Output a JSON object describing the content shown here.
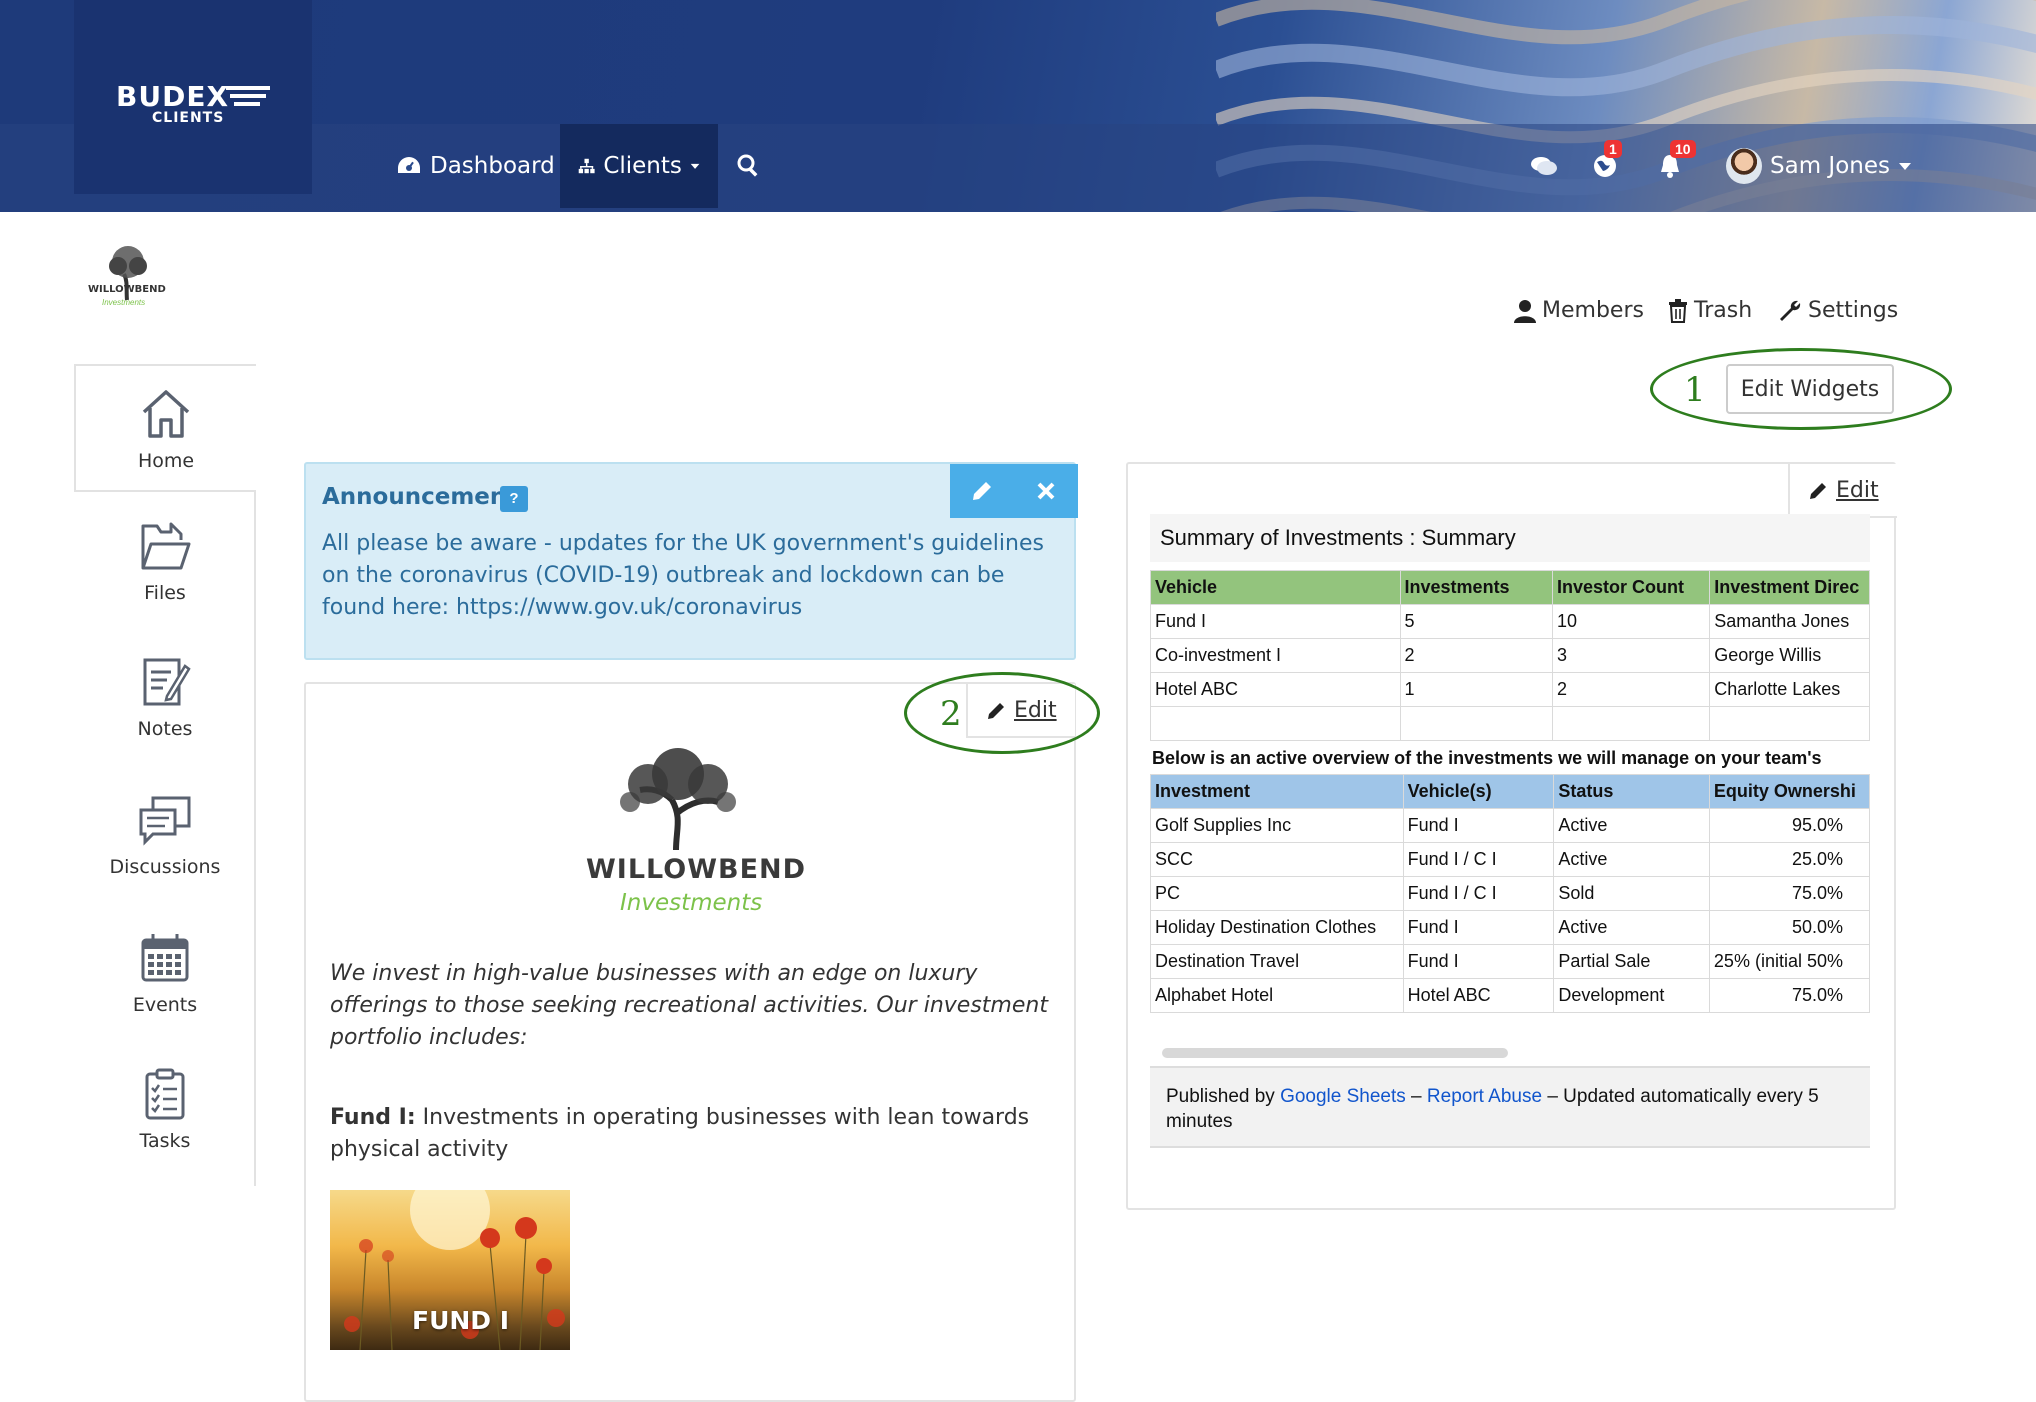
{
  "brand": {
    "name": "BUDEX",
    "sub": "CLIENTS"
  },
  "nav": {
    "dashboard": "Dashboard",
    "clients": "Clients",
    "messages_badge": "1",
    "notifications_badge": "10",
    "user_name": "Sam Jones"
  },
  "client_logo": {
    "name": "WILLOWBEND",
    "sub": "Investments"
  },
  "sidebar": {
    "items": [
      {
        "label": "Home",
        "icon": "home-icon"
      },
      {
        "label": "Files",
        "icon": "folder-icon"
      },
      {
        "label": "Notes",
        "icon": "note-icon"
      },
      {
        "label": "Discussions",
        "icon": "discussion-icon"
      },
      {
        "label": "Events",
        "icon": "calendar-icon"
      },
      {
        "label": "Tasks",
        "icon": "clipboard-icon"
      }
    ]
  },
  "toolbar": {
    "members": "Members",
    "trash": "Trash",
    "settings": "Settings",
    "edit_widgets": "Edit Widgets"
  },
  "annotations": {
    "marker_1": "1",
    "marker_2": "2"
  },
  "announcement": {
    "title": "Announcement",
    "help": "?",
    "body": "All please be aware - updates for the UK government's guidelines on the coronavirus (COVID-19) outbreak and lockdown can be found here: https://www.gov.uk/coronavirus"
  },
  "profile_widget": {
    "edit_label": "Edit",
    "logo_name": "WILLOWBEND",
    "logo_sub": "Investments",
    "intro": "We invest in high-value businesses with an edge on luxury offerings to those seeking recreational activities. Our investment portfolio includes:",
    "fund_label": "Fund I:",
    "fund_text": " Investments in operating businesses with lean towards physical activity",
    "fund_image_caption": "FUND I"
  },
  "summary_widget": {
    "edit_label": "Edit",
    "title": "Summary of Investments : Summary",
    "table1": {
      "headers": [
        "Vehicle",
        "Investments",
        "Investor Count",
        "Investment Direc"
      ],
      "rows": [
        [
          "Fund I",
          "5",
          "10",
          "Samantha Jones"
        ],
        [
          "Co-investment I",
          "2",
          "3",
          "George Willis"
        ],
        [
          "Hotel ABC",
          "1",
          "2",
          "Charlotte Lakes"
        ],
        [
          "",
          "",
          "",
          ""
        ]
      ]
    },
    "note": "Below is an active overview of the investments we will manage on your team's",
    "table2": {
      "headers": [
        "Investment",
        "Vehicle(s)",
        "Status",
        "Equity Ownershi"
      ],
      "rows": [
        [
          "Golf Supplies Inc",
          "Fund I",
          "Active",
          "95.0%"
        ],
        [
          "SCC",
          "Fund I / C I",
          "Active",
          "25.0%"
        ],
        [
          "PC",
          "Fund I / C I",
          "Sold",
          "75.0%"
        ],
        [
          "Holiday Destination Clothes",
          "Fund I",
          "Active",
          "50.0%"
        ],
        [
          "Destination Travel",
          "Fund I",
          "Partial Sale",
          "25% (initial 50%"
        ],
        [
          "Alphabet Hotel",
          "Hotel ABC",
          "Development",
          "75.0%"
        ]
      ]
    },
    "footer": {
      "published_by": "Published by ",
      "google_sheets": "Google Sheets",
      "dash1": " – ",
      "report_abuse": "Report Abuse",
      "dash2": " – ",
      "updated": "Updated automatically every 5 minutes"
    }
  }
}
